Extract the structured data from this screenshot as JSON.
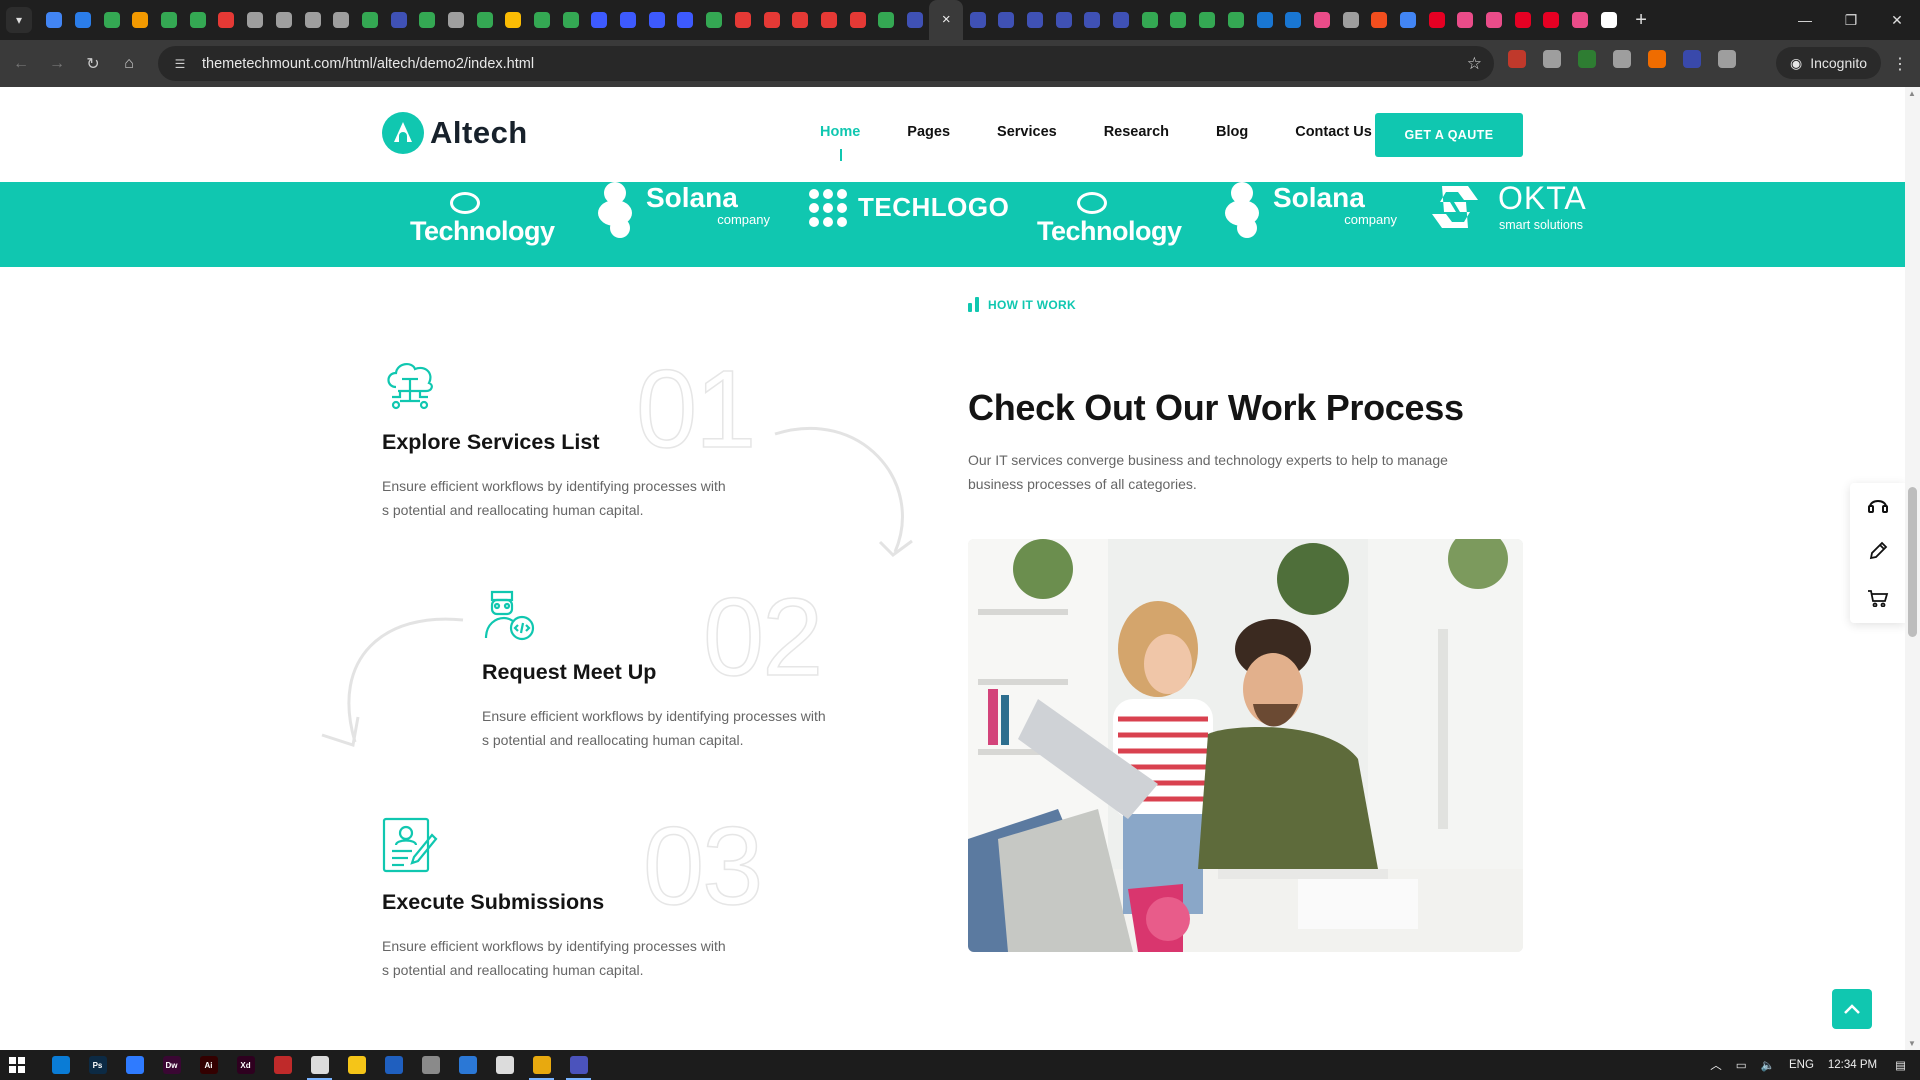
{
  "browser": {
    "active_tab_close": "×",
    "new_tab": "+",
    "url": "themetechmount.com/html/altech/demo2/index.html",
    "profile_label": "Incognito",
    "tab_favicon_colors": [
      "#4285f4",
      "#2b7de9",
      "#34a853",
      "#f29900",
      "#34a853",
      "#34a853",
      "#e53935",
      "#9e9e9e",
      "#9e9e9e",
      "#9e9e9e",
      "#9e9e9e",
      "#34a853",
      "#3f51b5",
      "#34a853",
      "#9e9e9e",
      "#34a853",
      "#fbbc04",
      "#34a853",
      "#34a853",
      "#3d5afe",
      "#3d5afe",
      "#3d5afe",
      "#3d5afe",
      "#34a853",
      "#e53935",
      "#e53935",
      "#e53935",
      "#e53935",
      "#e53935",
      "#34a853",
      "#3f51b5"
    ],
    "tab_favicon_colors_right": [
      "#3f51b5",
      "#3f51b5",
      "#3f51b5",
      "#3f51b5",
      "#3f51b5",
      "#3f51b5",
      "#34a853",
      "#34a853",
      "#34a853",
      "#34a853",
      "#1976d2",
      "#1976d2",
      "#ea4c89",
      "#9e9e9e",
      "#f24e1e",
      "#4285f4",
      "#e60023",
      "#ea4c89",
      "#ea4c89",
      "#e60023",
      "#e60023",
      "#ea4c89",
      "#ffffff"
    ],
    "extension_colors": [
      "#c0392b",
      "#9e9e9e",
      "#2e7d32",
      "#9e9e9e",
      "#ef6c00",
      "#3949ab",
      "#9e9e9e"
    ]
  },
  "header": {
    "logo_text": "Altech",
    "nav": [
      {
        "label": "Home",
        "active": true
      },
      {
        "label": "Pages",
        "active": false
      },
      {
        "label": "Services",
        "active": false
      },
      {
        "label": "Research",
        "active": false
      },
      {
        "label": "Blog",
        "active": false
      },
      {
        "label": "Contact Us",
        "active": false
      }
    ],
    "cta_label": "GET A QAUTE"
  },
  "brands": [
    {
      "name": "Technology"
    },
    {
      "name": "Solana",
      "sub": "company"
    },
    {
      "name": "TECHLOGO"
    },
    {
      "name": "Technology"
    },
    {
      "name": "Solana",
      "sub": "company"
    },
    {
      "name": "OKTA",
      "sub": "smart solutions"
    }
  ],
  "steps": [
    {
      "number": "01",
      "title": "Explore Services List",
      "desc_line1": "Ensure efficient workflows by identifying processes with",
      "desc_line2": "s potential and reallocating human capital.",
      "icon": "cloud-network-icon"
    },
    {
      "number": "02",
      "title": "Request Meet Up",
      "desc_line1": "Ensure efficient workflows by identifying processes with",
      "desc_line2": "s potential and reallocating human capital.",
      "icon": "developer-icon"
    },
    {
      "number": "03",
      "title": "Execute Submissions",
      "desc_line1": "Ensure efficient workflows by identifying processes with",
      "desc_line2": "s potential and reallocating human capital.",
      "icon": "document-edit-icon"
    }
  ],
  "process": {
    "label": "HOW IT WORK",
    "heading": "Check Out Our Work Process",
    "text_line1": "Our IT services converge business and technology experts to help to manage",
    "text_line2": "business processes of all categories."
  },
  "side_widget": [
    "headset-icon",
    "pencil-icon",
    "cart-icon"
  ],
  "colors": {
    "accent": "#10c7b0",
    "heading": "#141414",
    "body_text": "#666666"
  },
  "taskbar": {
    "lang": "ENG",
    "time": "12:34 PM",
    "apps": [
      {
        "label": "",
        "color": "#0a7cd6"
      },
      {
        "label": "Ps",
        "color": "#0c2a44"
      },
      {
        "label": "",
        "color": "#2f7bff"
      },
      {
        "label": "Dw",
        "color": "#3a0733"
      },
      {
        "label": "Ai",
        "color": "#330000"
      },
      {
        "label": "Xd",
        "color": "#2e001f"
      },
      {
        "label": "",
        "color": "#bf2a2a"
      },
      {
        "label": "",
        "color": "#dcdcdc"
      },
      {
        "label": "",
        "color": "#f5c518"
      },
      {
        "label": "",
        "color": "#1f5fbf"
      },
      {
        "label": "",
        "color": "#8a8a8a"
      },
      {
        "label": "",
        "color": "#2b78d6"
      },
      {
        "label": "",
        "color": "#dcdcdc"
      },
      {
        "label": "",
        "color": "#e8a90f"
      },
      {
        "label": "",
        "color": "#4b53bc"
      }
    ]
  }
}
